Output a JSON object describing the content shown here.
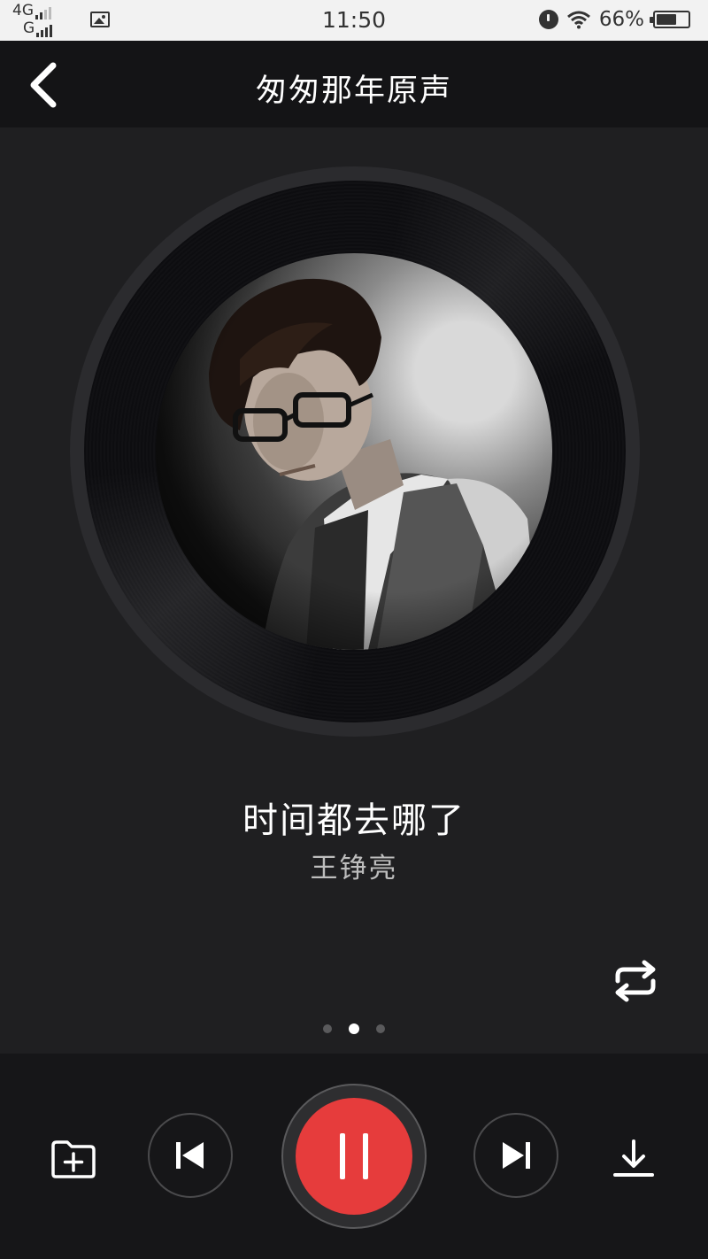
{
  "status_bar": {
    "network_top": "4G",
    "network_bottom": "G",
    "time": "11:50",
    "battery_percent": "66%",
    "battery_level": 0.66,
    "icons": [
      "signal-icon",
      "image-icon",
      "alarm-icon",
      "wifi-icon",
      "battery-icon"
    ]
  },
  "header": {
    "title": "匆匆那年原声",
    "back_icon": "chevron-left-icon"
  },
  "now_playing": {
    "song_title": "时间都去哪了",
    "artist": "王铮亮",
    "page_indicator": {
      "count": 3,
      "active_index": 1
    }
  },
  "controls": {
    "repeat_icon": "repeat-icon",
    "add_icon": "folder-add-icon",
    "prev_icon": "skip-previous-icon",
    "play_state_icon": "pause-icon",
    "next_icon": "skip-next-icon",
    "download_icon": "download-icon",
    "accent_color": "#e63c3c"
  },
  "colors": {
    "background": "#1f1f21",
    "header_bg": "#141416",
    "text_primary": "#ffffff",
    "text_secondary": "#bdbdbd"
  }
}
